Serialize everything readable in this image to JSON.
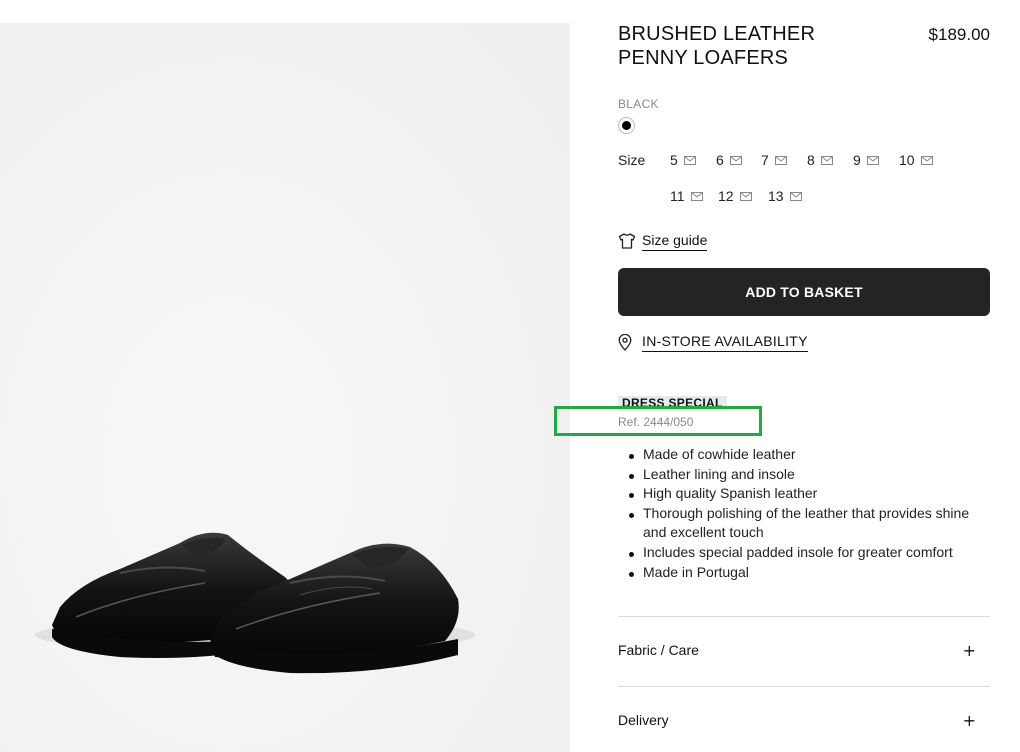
{
  "product": {
    "title": "BRUSHED LEATHER PENNY LOAFERS",
    "price": "$189.00",
    "image_icon": "loafer-shoes-image",
    "color": {
      "name": "BLACK",
      "swatch_hex": "#000000"
    },
    "size": {
      "label": "Size",
      "options": [
        "5",
        "6",
        "7",
        "8",
        "9",
        "10",
        "11",
        "12",
        "13"
      ],
      "option_icon": "envelope-icon"
    },
    "size_guide": {
      "label": "Size guide",
      "icon": "tshirt-icon"
    },
    "add_to_basket": "ADD TO BASKET",
    "in_store": {
      "label": "IN-STORE AVAILABILITY",
      "icon": "location-pin-icon"
    },
    "badge": "DRESS SPECIAL",
    "ref": "Ref. 2444/050",
    "features": [
      "Made of cowhide leather",
      "Leather lining and insole",
      "High quality Spanish leather",
      "Thorough polishing of the leather that provides shine and excellent touch",
      "Includes special padded insole for greater comfort",
      "Made in Portugal"
    ],
    "accordions": [
      {
        "label": "Fabric / Care",
        "icon": "+"
      },
      {
        "label": "Delivery",
        "icon": "+"
      }
    ]
  },
  "colors": {
    "button_bg": "#242424",
    "highlight": "#24a844",
    "gallery_bg": "#f4f4f4"
  }
}
